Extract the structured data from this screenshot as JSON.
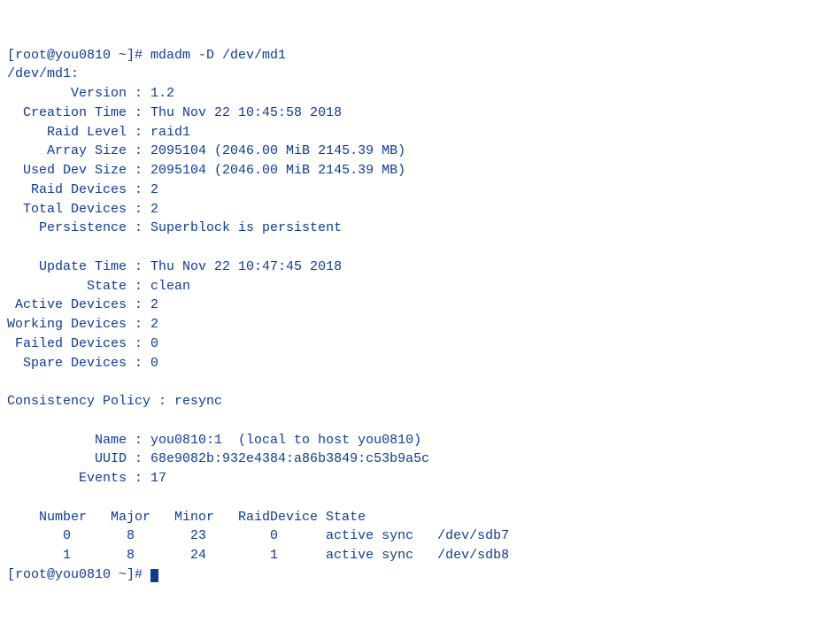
{
  "prompt": {
    "line": "[root@you0810 ~]# mdadm -D /dev/md1"
  },
  "device": "/dev/md1:",
  "fields": {
    "version_label": "        Version :",
    "version_value": " 1.2",
    "creation_label": "  Creation Time :",
    "creation_value": " Thu Nov 22 10:45:58 2018",
    "raidlevel_label": "     Raid Level :",
    "raidlevel_value": " raid1",
    "arraysize_label": "     Array Size :",
    "arraysize_value": " 2095104 (2046.00 MiB 2145.39 MB)",
    "useddev_label": "  Used Dev Size :",
    "useddev_value": " 2095104 (2046.00 MiB 2145.39 MB)",
    "raiddev_label": "   Raid Devices :",
    "raiddev_value": " 2",
    "totaldev_label": "  Total Devices :",
    "totaldev_value": " 2",
    "persist_label": "    Persistence :",
    "persist_value": " Superblock is persistent",
    "update_label": "    Update Time :",
    "update_value": " Thu Nov 22 10:47:45 2018",
    "state_label": "          State :",
    "state_value": " clean",
    "active_label": " Active Devices :",
    "active_value": " 2",
    "working_label": "Working Devices :",
    "working_value": " 2",
    "failed_label": " Failed Devices :",
    "failed_value": " 0",
    "spare_label": "  Spare Devices :",
    "spare_value": " 0",
    "consist_label": "Consistency Policy :",
    "consist_value": " resync",
    "name_label": "           Name :",
    "name_value": " you0810:1  (local to host you0810)",
    "uuid_label": "           UUID :",
    "uuid_value": " 68e9082b:932e4384:a86b3849:c53b9a5c",
    "events_label": "         Events :",
    "events_value": " 17"
  },
  "table": {
    "header": "    Number   Major   Minor   RaidDevice State",
    "row0": "       0       8       23        0      active sync   /dev/sdb7",
    "row1": "       1       8       24        1      active sync   /dev/sdb8"
  },
  "trailing_prompt": "[root@you0810 ~]# "
}
